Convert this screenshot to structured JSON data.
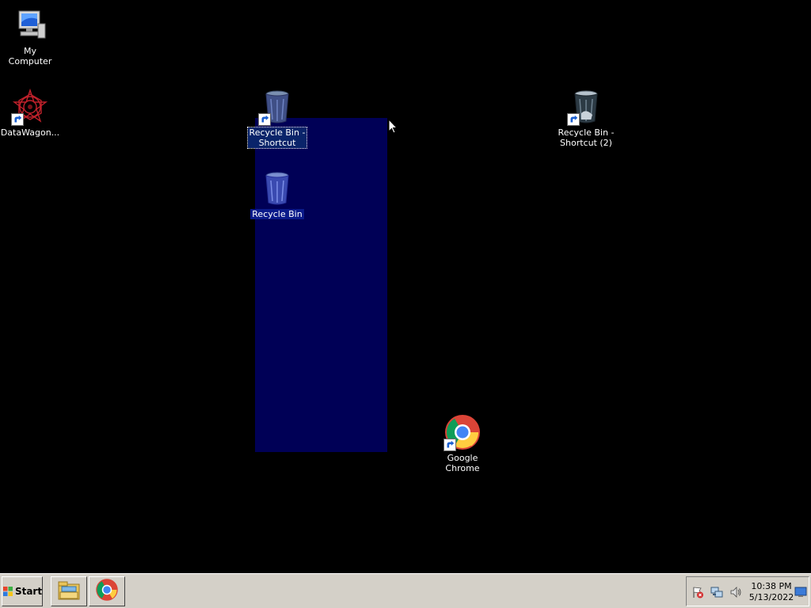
{
  "desktop": {
    "background_color": "#000000",
    "icons": [
      {
        "label": "My Computer",
        "icon": "computer-icon",
        "shortcut": false
      },
      {
        "label": "DataWagon...",
        "icon": "datawagon-icon",
        "shortcut": true
      },
      {
        "label": "Recycle Bin -\nShortcut",
        "icon": "recycle-bin-icon",
        "shortcut": true,
        "state": "selected-focused"
      },
      {
        "label": "Recycle Bin",
        "icon": "recycle-bin-icon",
        "shortcut": false,
        "state": "selected"
      },
      {
        "label": "Recycle Bin -\nShortcut (2)",
        "icon": "recycle-bin-icon",
        "shortcut": true
      },
      {
        "label": "Google Chrome",
        "icon": "chrome-icon",
        "shortcut": true
      }
    ],
    "selection_rectangle_color": "#00006e"
  },
  "taskbar": {
    "start_label": "Start",
    "quick_launch": [
      {
        "name": "file-explorer-icon"
      },
      {
        "name": "chrome-icon"
      }
    ],
    "tray_icons": [
      "action-center-flag-icon",
      "network-icon",
      "volume-icon"
    ],
    "clock": {
      "time": "10:38 PM",
      "date": "5/13/2022"
    },
    "show_desktop": "show-desktop-icon"
  }
}
